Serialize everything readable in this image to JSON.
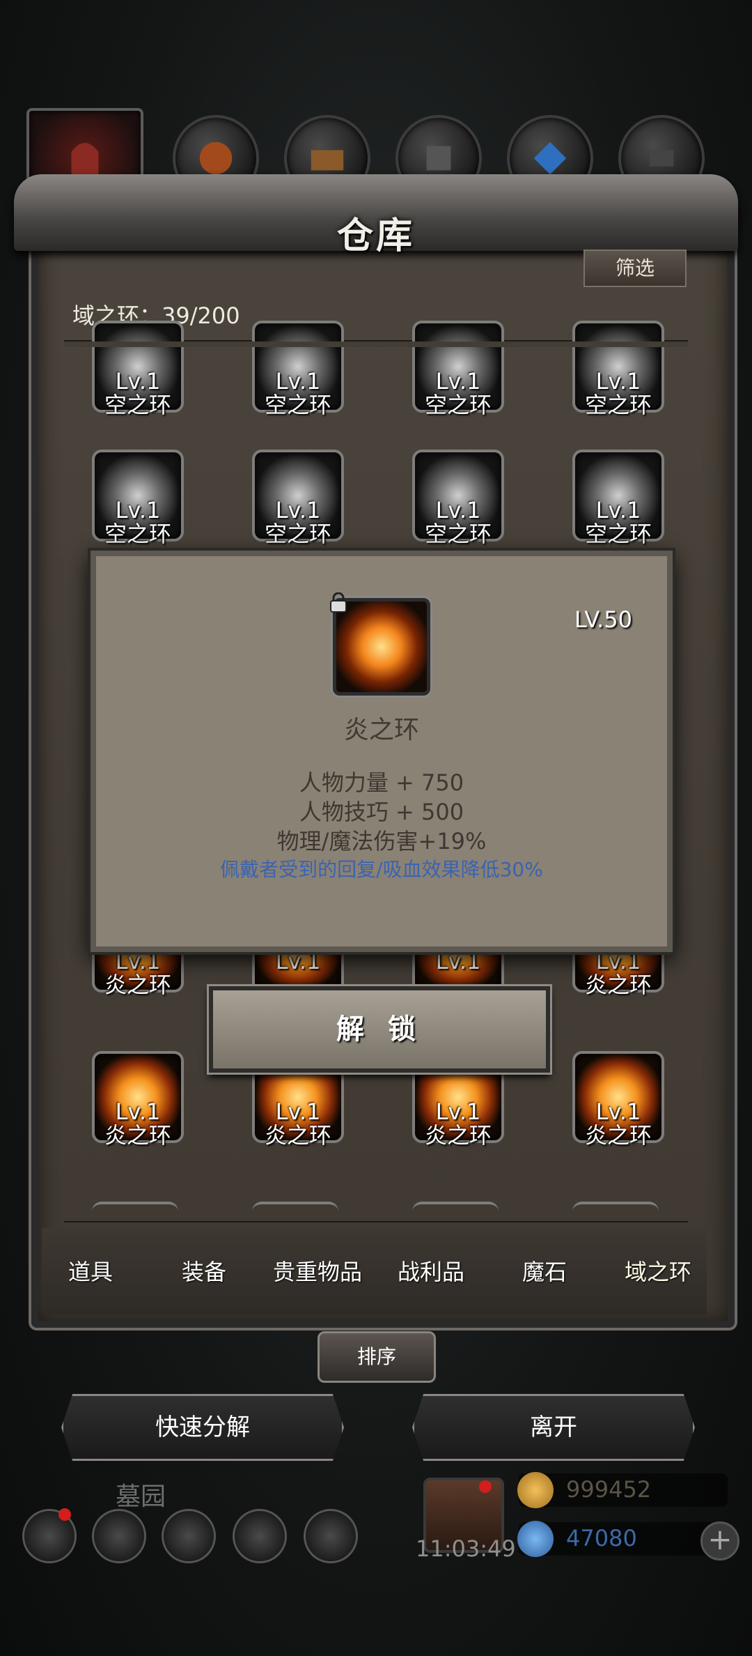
{
  "window": {
    "title": "仓库",
    "filter_label": "筛选"
  },
  "inventory": {
    "count_label": "域之环：39/200"
  },
  "grid": {
    "row1": [
      {
        "lv": "Lv.1",
        "name": "空之环"
      },
      {
        "lv": "Lv.1",
        "name": "空之环"
      },
      {
        "lv": "Lv.1",
        "name": "空之环"
      },
      {
        "lv": "Lv.1",
        "name": "空之环"
      }
    ],
    "row2": [
      {
        "lv": "Lv.1",
        "name": "空之环"
      },
      {
        "lv": "Lv.1",
        "name": "空之环"
      },
      {
        "lv": "Lv.1",
        "name": "空之环"
      },
      {
        "lv": "Lv.1",
        "name": "空之环"
      }
    ],
    "row3": [
      {
        "lv": "Lv.1",
        "name": "炎之环"
      },
      {
        "lv": "Lv.1",
        "name": ""
      },
      {
        "lv": "Lv.1",
        "name": ""
      },
      {
        "lv": "Lv.1",
        "name": "炎之环"
      }
    ],
    "row4": [
      {
        "lv": "Lv.1",
        "name": "炎之环"
      },
      {
        "lv": "Lv.1",
        "name": "炎之环"
      },
      {
        "lv": "Lv.1",
        "name": "炎之环"
      },
      {
        "lv": "Lv.1",
        "name": "炎之环"
      }
    ]
  },
  "popup": {
    "level": "LV.50",
    "item_name": "炎之环",
    "stats": [
      "人物力量 + 750",
      "人物技巧 + 500",
      "物理/魔法伤害+19%"
    ],
    "note": "佩戴者受到的回复/吸血效果降低30%",
    "unlock_label": "解 锁"
  },
  "categories": [
    "道具",
    "装备",
    "贵重物品",
    "战利品",
    "魔石",
    "域之环"
  ],
  "active_category": "域之环",
  "sort_label": "排序",
  "actions": {
    "quick_decompose": "快速分解",
    "leave": "离开"
  },
  "hud": {
    "location": "墓园",
    "time": "11:03:49",
    "gold": "999452",
    "gems": "47080",
    "plus_label": "+"
  }
}
